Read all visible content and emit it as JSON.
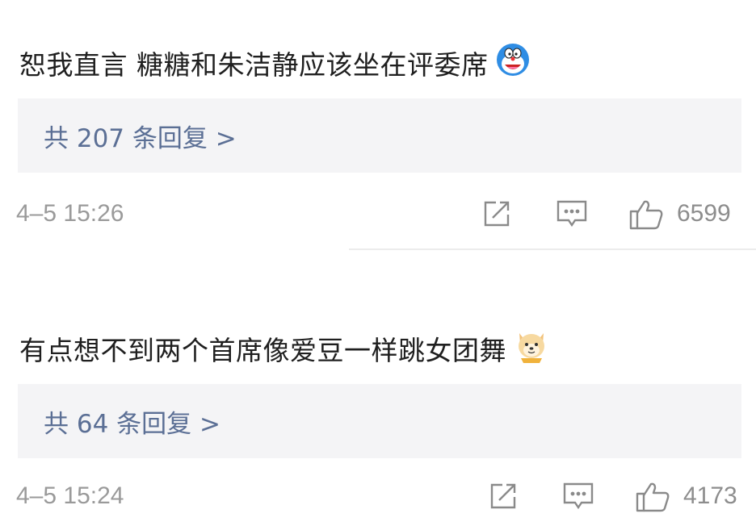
{
  "comments": [
    {
      "username": "",
      "text": "恕我直言 糖糖和朱洁静应该坐在评委席",
      "emoji": "doraemon-emoji",
      "replies_label": "共 207 条回复 >",
      "timestamp": "4–5 15:26",
      "likes": "6599"
    },
    {
      "username": "",
      "text": "有点想不到两个首席像爱豆一样跳女团舞",
      "emoji": "shiba-dog-emoji",
      "replies_label": "共 64 条回复 >",
      "timestamp": "4–5 15:24",
      "likes": "4173"
    }
  ],
  "colors": {
    "reply_link": "#5b6f95",
    "reply_bg": "#f4f4f6",
    "meta_text": "#9a9a9a",
    "icon_stroke": "#8a8a8a"
  }
}
